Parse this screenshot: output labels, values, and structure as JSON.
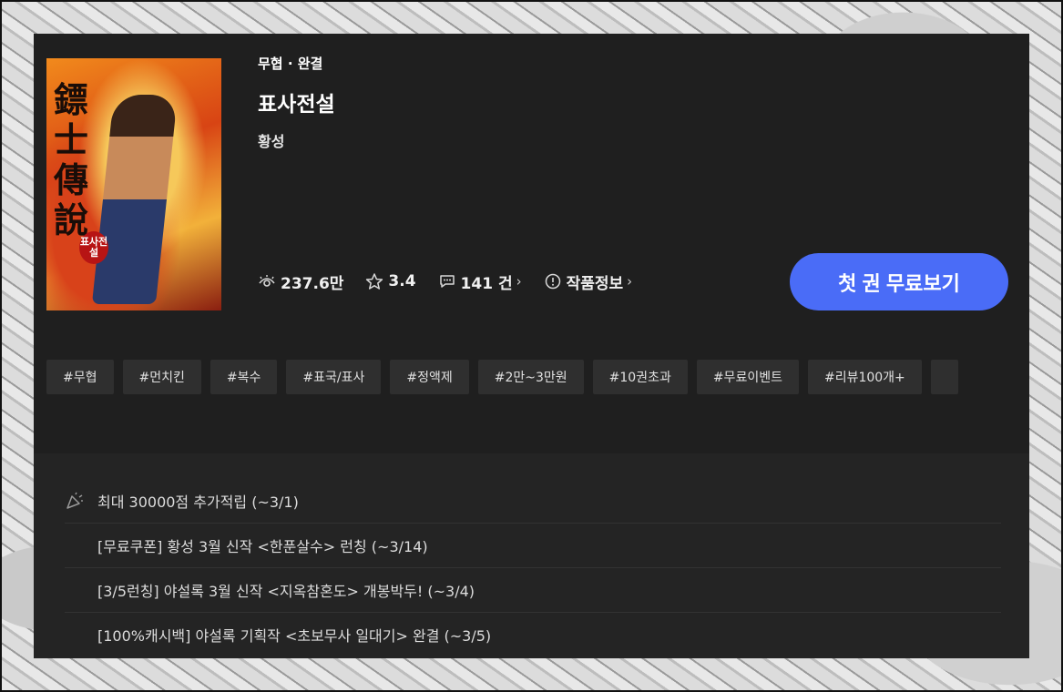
{
  "book": {
    "genre_status": "무협 · 완결",
    "title": "표사전설",
    "author": "황성",
    "cover": {
      "calligraphy": "鏢士傳說",
      "badge": "표사전설",
      "colors": {
        "primary": "#f18a1c",
        "secondary": "#d84414",
        "accent": "#f2b13a"
      }
    }
  },
  "stats": {
    "views": "237.6만",
    "rating": "3.4",
    "comments": "141 건",
    "info_label": "작품정보",
    "icons": [
      "eye-icon",
      "star-icon",
      "comment-icon",
      "info-icon"
    ]
  },
  "cta": {
    "label": "첫 권 무료보기",
    "color": "#4a6cf7"
  },
  "tags": [
    "#무협",
    "#먼치킨",
    "#복수",
    "#표국/표사",
    "#정액제",
    "#2만~3만원",
    "#10권초과",
    "#무료이벤트",
    "#리뷰100개+"
  ],
  "events": [
    {
      "text": "최대 30000점 추가적립 (~3/1)",
      "icon": "party-popper-icon"
    },
    {
      "text": "[무료쿠폰] 황성 3월 신작 <한푼살수> 런칭 (~3/14)"
    },
    {
      "text": "[3/5런칭] 야설록 3월 신작 <지옥참혼도> 개봉박두! (~3/4)"
    },
    {
      "text": "[100%캐시백] 야설록 기획작 <초보무사 일대기> 완결 (~3/5)"
    }
  ]
}
